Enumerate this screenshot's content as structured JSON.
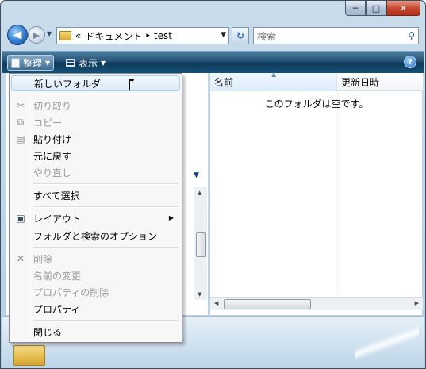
{
  "window": {
    "caption": {
      "minimize": "─",
      "maximize": "□",
      "close": "✕"
    }
  },
  "address_bar": {
    "back_glyph": "◀",
    "forward_glyph": "▶",
    "prefix": "«",
    "crumbs": [
      "ドキュメント",
      "test"
    ],
    "separator": "▸",
    "refresh_glyph": "↻"
  },
  "search": {
    "placeholder": "検索",
    "icon": "search-icon"
  },
  "toolbar": {
    "organize_label": "整理",
    "view_label": "表示",
    "help_label": "?"
  },
  "columns": {
    "name": "名前",
    "modified": "更新日時"
  },
  "empty_message": "このフォルダは空です。",
  "menu": {
    "items": [
      {
        "label": "新しいフォルダ",
        "enabled": true,
        "hover": true
      },
      {
        "label": "切り取り",
        "enabled": false,
        "icon": "scissors-icon"
      },
      {
        "label": "コピー",
        "enabled": false,
        "icon": "copy-icon"
      },
      {
        "label": "貼り付け",
        "enabled": true,
        "icon": "clipboard-icon"
      },
      {
        "label": "元に戻す",
        "enabled": true
      },
      {
        "label": "やり直し",
        "enabled": false
      },
      {
        "label": "すべて選択",
        "enabled": true
      },
      {
        "label": "レイアウト",
        "enabled": true,
        "icon": "layout-icon",
        "submenu": true
      },
      {
        "label": "フォルダと検索のオプション",
        "enabled": true
      },
      {
        "label": "削除",
        "enabled": false,
        "icon": "delete-x-icon"
      },
      {
        "label": "名前の変更",
        "enabled": false
      },
      {
        "label": "プロパティの削除",
        "enabled": false
      },
      {
        "label": "プロパティ",
        "enabled": true
      },
      {
        "label": "閉じる",
        "enabled": true
      }
    ]
  },
  "colors": {
    "toolbar_dark": "#0e3858",
    "accent": "#2a6fc4",
    "disabled_text": "#9b9b9b"
  }
}
